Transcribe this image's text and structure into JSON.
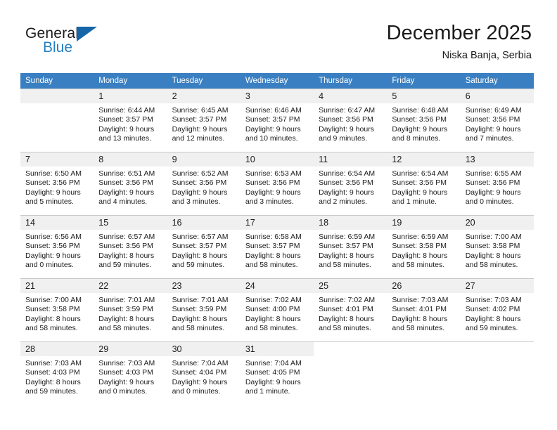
{
  "brand": {
    "word_general": "General",
    "word_blue": "Blue",
    "triangle_color": "#1565a8",
    "blue_color": "#2580c3"
  },
  "header": {
    "title": "December 2025",
    "subtitle": "Niska Banja, Serbia"
  },
  "theme": {
    "header_row_bg": "#3a7fc1",
    "daynum_band_bg": "#f0f0f0",
    "grid_line": "#c8c8c8"
  },
  "weekdays": [
    "Sunday",
    "Monday",
    "Tuesday",
    "Wednesday",
    "Thursday",
    "Friday",
    "Saturday"
  ],
  "weeks": [
    [
      {
        "day": "",
        "sunrise": "",
        "sunset": "",
        "daylight1": "",
        "daylight2": "",
        "empty": true
      },
      {
        "day": "1",
        "sunrise": "Sunrise: 6:44 AM",
        "sunset": "Sunset: 3:57 PM",
        "daylight1": "Daylight: 9 hours",
        "daylight2": "and 13 minutes."
      },
      {
        "day": "2",
        "sunrise": "Sunrise: 6:45 AM",
        "sunset": "Sunset: 3:57 PM",
        "daylight1": "Daylight: 9 hours",
        "daylight2": "and 12 minutes."
      },
      {
        "day": "3",
        "sunrise": "Sunrise: 6:46 AM",
        "sunset": "Sunset: 3:57 PM",
        "daylight1": "Daylight: 9 hours",
        "daylight2": "and 10 minutes."
      },
      {
        "day": "4",
        "sunrise": "Sunrise: 6:47 AM",
        "sunset": "Sunset: 3:56 PM",
        "daylight1": "Daylight: 9 hours",
        "daylight2": "and 9 minutes."
      },
      {
        "day": "5",
        "sunrise": "Sunrise: 6:48 AM",
        "sunset": "Sunset: 3:56 PM",
        "daylight1": "Daylight: 9 hours",
        "daylight2": "and 8 minutes."
      },
      {
        "day": "6",
        "sunrise": "Sunrise: 6:49 AM",
        "sunset": "Sunset: 3:56 PM",
        "daylight1": "Daylight: 9 hours",
        "daylight2": "and 7 minutes."
      }
    ],
    [
      {
        "day": "7",
        "sunrise": "Sunrise: 6:50 AM",
        "sunset": "Sunset: 3:56 PM",
        "daylight1": "Daylight: 9 hours",
        "daylight2": "and 5 minutes."
      },
      {
        "day": "8",
        "sunrise": "Sunrise: 6:51 AM",
        "sunset": "Sunset: 3:56 PM",
        "daylight1": "Daylight: 9 hours",
        "daylight2": "and 4 minutes."
      },
      {
        "day": "9",
        "sunrise": "Sunrise: 6:52 AM",
        "sunset": "Sunset: 3:56 PM",
        "daylight1": "Daylight: 9 hours",
        "daylight2": "and 3 minutes."
      },
      {
        "day": "10",
        "sunrise": "Sunrise: 6:53 AM",
        "sunset": "Sunset: 3:56 PM",
        "daylight1": "Daylight: 9 hours",
        "daylight2": "and 3 minutes."
      },
      {
        "day": "11",
        "sunrise": "Sunrise: 6:54 AM",
        "sunset": "Sunset: 3:56 PM",
        "daylight1": "Daylight: 9 hours",
        "daylight2": "and 2 minutes."
      },
      {
        "day": "12",
        "sunrise": "Sunrise: 6:54 AM",
        "sunset": "Sunset: 3:56 PM",
        "daylight1": "Daylight: 9 hours",
        "daylight2": "and 1 minute."
      },
      {
        "day": "13",
        "sunrise": "Sunrise: 6:55 AM",
        "sunset": "Sunset: 3:56 PM",
        "daylight1": "Daylight: 9 hours",
        "daylight2": "and 0 minutes."
      }
    ],
    [
      {
        "day": "14",
        "sunrise": "Sunrise: 6:56 AM",
        "sunset": "Sunset: 3:56 PM",
        "daylight1": "Daylight: 9 hours",
        "daylight2": "and 0 minutes."
      },
      {
        "day": "15",
        "sunrise": "Sunrise: 6:57 AM",
        "sunset": "Sunset: 3:56 PM",
        "daylight1": "Daylight: 8 hours",
        "daylight2": "and 59 minutes."
      },
      {
        "day": "16",
        "sunrise": "Sunrise: 6:57 AM",
        "sunset": "Sunset: 3:57 PM",
        "daylight1": "Daylight: 8 hours",
        "daylight2": "and 59 minutes."
      },
      {
        "day": "17",
        "sunrise": "Sunrise: 6:58 AM",
        "sunset": "Sunset: 3:57 PM",
        "daylight1": "Daylight: 8 hours",
        "daylight2": "and 58 minutes."
      },
      {
        "day": "18",
        "sunrise": "Sunrise: 6:59 AM",
        "sunset": "Sunset: 3:57 PM",
        "daylight1": "Daylight: 8 hours",
        "daylight2": "and 58 minutes."
      },
      {
        "day": "19",
        "sunrise": "Sunrise: 6:59 AM",
        "sunset": "Sunset: 3:58 PM",
        "daylight1": "Daylight: 8 hours",
        "daylight2": "and 58 minutes."
      },
      {
        "day": "20",
        "sunrise": "Sunrise: 7:00 AM",
        "sunset": "Sunset: 3:58 PM",
        "daylight1": "Daylight: 8 hours",
        "daylight2": "and 58 minutes."
      }
    ],
    [
      {
        "day": "21",
        "sunrise": "Sunrise: 7:00 AM",
        "sunset": "Sunset: 3:58 PM",
        "daylight1": "Daylight: 8 hours",
        "daylight2": "and 58 minutes."
      },
      {
        "day": "22",
        "sunrise": "Sunrise: 7:01 AM",
        "sunset": "Sunset: 3:59 PM",
        "daylight1": "Daylight: 8 hours",
        "daylight2": "and 58 minutes."
      },
      {
        "day": "23",
        "sunrise": "Sunrise: 7:01 AM",
        "sunset": "Sunset: 3:59 PM",
        "daylight1": "Daylight: 8 hours",
        "daylight2": "and 58 minutes."
      },
      {
        "day": "24",
        "sunrise": "Sunrise: 7:02 AM",
        "sunset": "Sunset: 4:00 PM",
        "daylight1": "Daylight: 8 hours",
        "daylight2": "and 58 minutes."
      },
      {
        "day": "25",
        "sunrise": "Sunrise: 7:02 AM",
        "sunset": "Sunset: 4:01 PM",
        "daylight1": "Daylight: 8 hours",
        "daylight2": "and 58 minutes."
      },
      {
        "day": "26",
        "sunrise": "Sunrise: 7:03 AM",
        "sunset": "Sunset: 4:01 PM",
        "daylight1": "Daylight: 8 hours",
        "daylight2": "and 58 minutes."
      },
      {
        "day": "27",
        "sunrise": "Sunrise: 7:03 AM",
        "sunset": "Sunset: 4:02 PM",
        "daylight1": "Daylight: 8 hours",
        "daylight2": "and 59 minutes."
      }
    ],
    [
      {
        "day": "28",
        "sunrise": "Sunrise: 7:03 AM",
        "sunset": "Sunset: 4:03 PM",
        "daylight1": "Daylight: 8 hours",
        "daylight2": "and 59 minutes."
      },
      {
        "day": "29",
        "sunrise": "Sunrise: 7:03 AM",
        "sunset": "Sunset: 4:03 PM",
        "daylight1": "Daylight: 9 hours",
        "daylight2": "and 0 minutes."
      },
      {
        "day": "30",
        "sunrise": "Sunrise: 7:04 AM",
        "sunset": "Sunset: 4:04 PM",
        "daylight1": "Daylight: 9 hours",
        "daylight2": "and 0 minutes."
      },
      {
        "day": "31",
        "sunrise": "Sunrise: 7:04 AM",
        "sunset": "Sunset: 4:05 PM",
        "daylight1": "Daylight: 9 hours",
        "daylight2": "and 1 minute."
      },
      {
        "day": "",
        "sunrise": "",
        "sunset": "",
        "daylight1": "",
        "daylight2": "",
        "blank": true
      },
      {
        "day": "",
        "sunrise": "",
        "sunset": "",
        "daylight1": "",
        "daylight2": "",
        "blank": true
      },
      {
        "day": "",
        "sunrise": "",
        "sunset": "",
        "daylight1": "",
        "daylight2": "",
        "blank": true
      }
    ]
  ]
}
